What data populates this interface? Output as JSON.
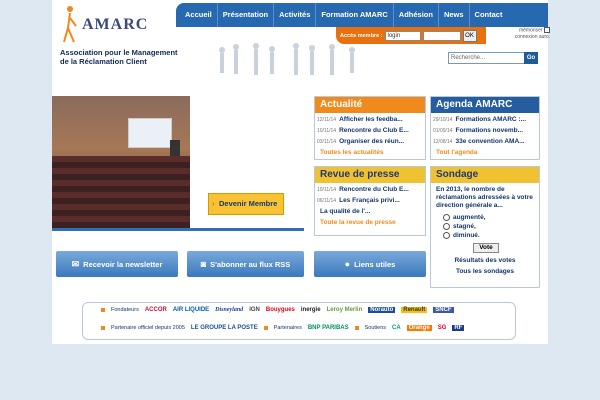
{
  "logo": {
    "brand": "AMARC",
    "subtitle_line1": "Association pour le Management",
    "subtitle_line2": "de la Réclamation Client"
  },
  "nav": {
    "items": [
      "Accueil",
      "Présentation",
      "Activités",
      "Formation AMARC",
      "Adhésion",
      "News",
      "Contact"
    ]
  },
  "login": {
    "label": "Accès membre :",
    "value": "login",
    "ok": "OK",
    "memorise": "mémoriser",
    "auto": "connexion auto."
  },
  "search": {
    "placeholder": "Recherche...",
    "go": "Go"
  },
  "devenir": "Devenir Membre",
  "actualite": {
    "title": "Actualité",
    "items": [
      {
        "date": "12/11/14",
        "text": "Afficher les feedba..."
      },
      {
        "date": "10/11/14",
        "text": "Rencontre du Club E..."
      },
      {
        "date": "03/11/14",
        "text": "Organiser des réun..."
      }
    ],
    "more": "Toutes les actualités"
  },
  "agenda": {
    "title": "Agenda AMARC",
    "items": [
      {
        "date": "29/10/14",
        "text": "Formations AMARC :..."
      },
      {
        "date": "01/09/14",
        "text": "Formations novemb..."
      },
      {
        "date": "12/08/14",
        "text": "33e convention AMA..."
      }
    ],
    "more": "Tout l'agenda"
  },
  "revue": {
    "title": "Revue de presse",
    "items": [
      {
        "date": "10/11/14",
        "text": "Rencontre du Club E..."
      },
      {
        "date": "06/11/14",
        "text": "Les Français privi..."
      },
      {
        "date": "",
        "text": "La qualité de l'..."
      }
    ],
    "more": "Toute la revue de presse"
  },
  "sondage": {
    "title": "Sondage",
    "question": "En 2013, le nombre de réclamations adressées à votre direction générale a...",
    "options": [
      "augmenté,",
      "stagné,",
      "diminué."
    ],
    "vote": "Vote",
    "results": "Résultats des votes",
    "all": "Tous les sondages"
  },
  "buttons": {
    "newsletter": "Recevoir la newsletter",
    "rss": "S'abonner au flux RSS",
    "liens": "Liens utiles"
  },
  "partners": {
    "row1_label": "Fondateurs",
    "row1": [
      "ACCOR",
      "AIR LIQUIDE",
      "Disneyland",
      "IGN",
      "Bouygues",
      "inergie",
      "Leroy Merlin",
      "Norauto",
      "Renault",
      "SNCF"
    ],
    "row2_label": "Partenaire officiel depuis 2005",
    "row2_logo": "LE GROUPE LA POSTE",
    "row3_label": "Partenaires",
    "row3": [
      "BNP PARIBAS"
    ],
    "row4_label": "Soutiens",
    "row4": [
      "CA",
      "Orange",
      "SG",
      "RF"
    ]
  },
  "colors": {
    "nav_blue": "#2669b0",
    "orange": "#f08a1c",
    "yellow": "#f0c232"
  }
}
